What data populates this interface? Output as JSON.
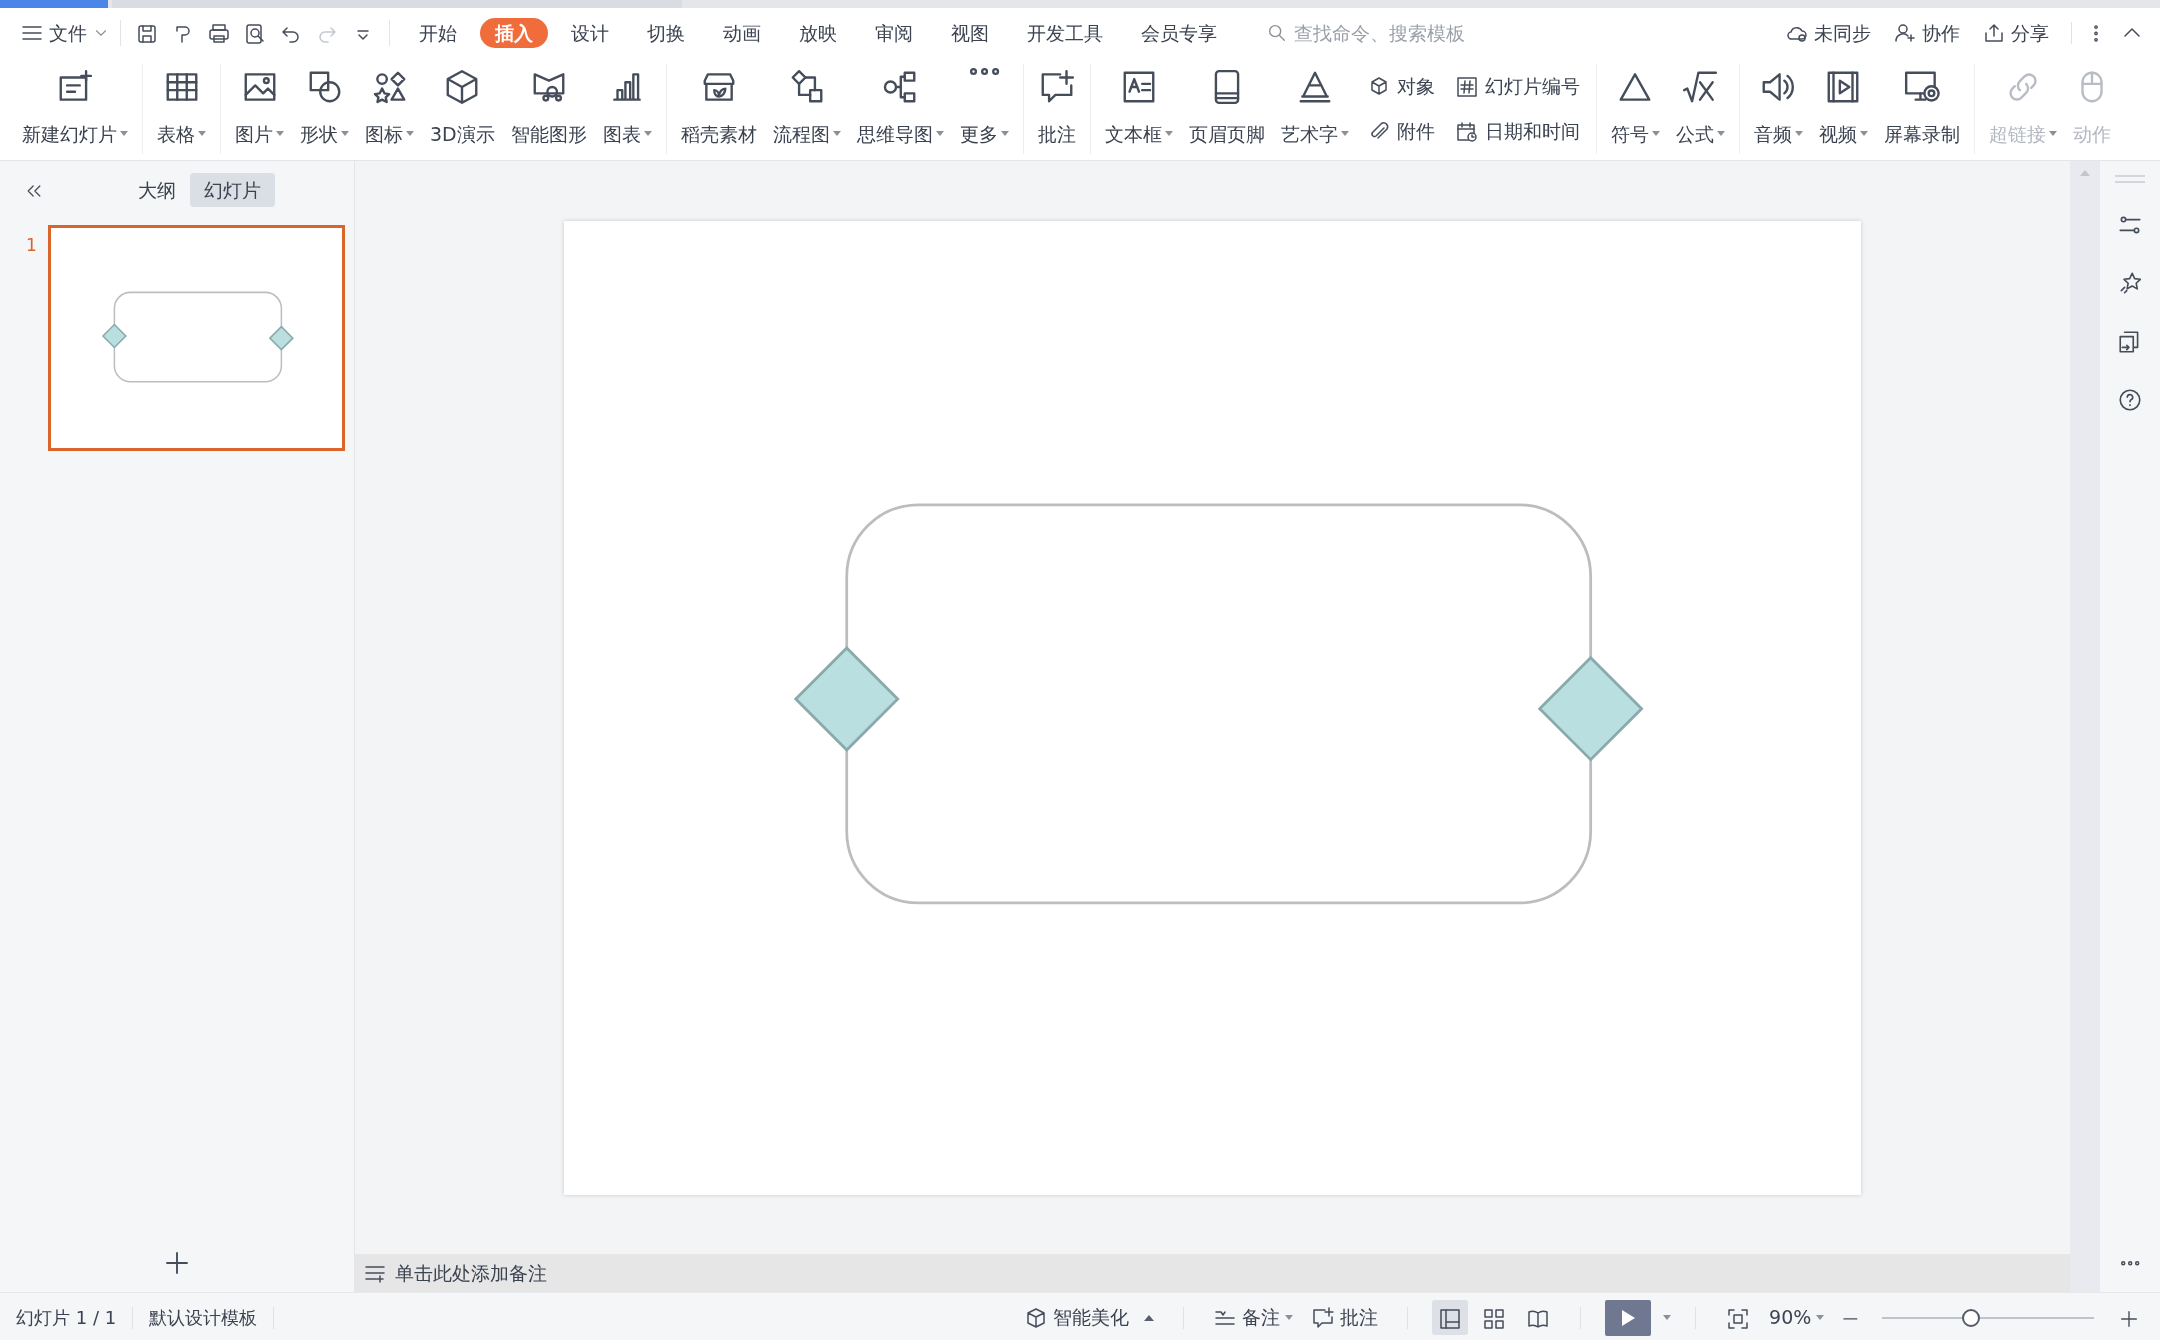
{
  "menu": {
    "file_label": "文件",
    "quick_access": [
      {
        "disabled": false
      },
      {
        "disabled": false
      },
      {
        "disabled": false
      },
      {
        "disabled": false
      },
      {
        "disabled": false
      },
      {
        "disabled": true
      },
      {
        "disabled": false
      }
    ],
    "tabs": [
      {
        "label": "开始",
        "selected": false
      },
      {
        "label": "插入",
        "selected": true
      },
      {
        "label": "设计",
        "selected": false
      },
      {
        "label": "切换",
        "selected": false
      },
      {
        "label": "动画",
        "selected": false
      },
      {
        "label": "放映",
        "selected": false
      },
      {
        "label": "审阅",
        "selected": false
      },
      {
        "label": "视图",
        "selected": false
      },
      {
        "label": "开发工具",
        "selected": false
      },
      {
        "label": "会员专享",
        "selected": false
      }
    ],
    "search": {
      "placeholder": "查找命令、搜索模板"
    },
    "account_actions": [
      {
        "label": "未同步"
      },
      {
        "label": "协作"
      },
      {
        "label": "分享"
      }
    ]
  },
  "ribbon": {
    "groups": [
      {
        "items": [
          {
            "kind": "large",
            "label": "新建幻灯片",
            "dropdown": true,
            "disabled": false
          }
        ]
      },
      {
        "items": [
          {
            "kind": "large",
            "label": "表格",
            "dropdown": true,
            "disabled": false
          }
        ]
      },
      {
        "items": [
          {
            "kind": "large",
            "label": "图片",
            "dropdown": true,
            "disabled": false
          },
          {
            "kind": "large",
            "label": "形状",
            "dropdown": true,
            "disabled": false
          },
          {
            "kind": "large",
            "label": "图标",
            "dropdown": true,
            "disabled": false
          },
          {
            "kind": "large",
            "label": "3D演示",
            "dropdown": false,
            "disabled": false
          },
          {
            "kind": "large",
            "label": "智能图形",
            "dropdown": false,
            "disabled": false
          },
          {
            "kind": "large",
            "label": "图表",
            "dropdown": true,
            "disabled": false
          }
        ]
      },
      {
        "items": [
          {
            "kind": "large",
            "label": "稻壳素材",
            "dropdown": false,
            "disabled": false
          },
          {
            "kind": "large",
            "label": "流程图",
            "dropdown": true,
            "disabled": false
          },
          {
            "kind": "large",
            "label": "思维导图",
            "dropdown": true,
            "disabled": false
          },
          {
            "kind": "large",
            "label": "更多",
            "dropdown": true,
            "disabled": false
          }
        ]
      },
      {
        "items": [
          {
            "kind": "large",
            "label": "批注",
            "dropdown": false,
            "disabled": false
          }
        ]
      },
      {
        "items": [
          {
            "kind": "large",
            "label": "文本框",
            "dropdown": true,
            "disabled": false
          },
          {
            "kind": "large",
            "label": "页眉页脚",
            "dropdown": false,
            "disabled": false
          },
          {
            "kind": "large",
            "label": "艺术字",
            "dropdown": true,
            "disabled": false
          },
          {
            "kind": "small",
            "label": "对象",
            "dropdown": false,
            "disabled": false
          },
          {
            "kind": "small",
            "label": "附件",
            "dropdown": false,
            "disabled": false
          },
          {
            "kind": "small",
            "label": "幻灯片编号",
            "dropdown": false,
            "disabled": false
          },
          {
            "kind": "small",
            "label": "日期和时间",
            "dropdown": false,
            "disabled": false
          }
        ]
      },
      {
        "items": [
          {
            "kind": "large",
            "label": "符号",
            "dropdown": true,
            "disabled": false
          },
          {
            "kind": "large",
            "label": "公式",
            "dropdown": true,
            "disabled": false
          }
        ]
      },
      {
        "items": [
          {
            "kind": "large",
            "label": "音频",
            "dropdown": true,
            "disabled": false
          },
          {
            "kind": "large",
            "label": "视频",
            "dropdown": true,
            "disabled": false
          },
          {
            "kind": "large",
            "label": "屏幕录制",
            "dropdown": false,
            "disabled": false
          }
        ]
      },
      {
        "items": [
          {
            "kind": "large",
            "label": "超链接",
            "dropdown": true,
            "disabled": true
          },
          {
            "kind": "large",
            "label": "动作",
            "dropdown": false,
            "disabled": true
          }
        ]
      }
    ]
  },
  "panel": {
    "tabs": [
      {
        "label": "大纲",
        "selected": false
      },
      {
        "label": "幻灯片",
        "selected": true
      }
    ],
    "slides": [
      {
        "number": "1",
        "selected": true
      }
    ]
  },
  "slide": {
    "shapes": [
      {
        "kind": "rounded-rectangle"
      },
      {
        "kind": "diamond"
      },
      {
        "kind": "diamond"
      }
    ]
  },
  "notes": {
    "prompt": "单击此处添加备注"
  },
  "status_bar": {
    "slide_info": "幻灯片 1 / 1",
    "template": "默认设计模板",
    "smart_beautify": "智能美化",
    "notes": "备注",
    "comments": "批注",
    "views": [
      {
        "selected": true
      },
      {
        "selected": false
      },
      {
        "selected": false
      }
    ],
    "zoom": "90%",
    "zoom_slider": {
      "level": 0.42
    }
  }
}
